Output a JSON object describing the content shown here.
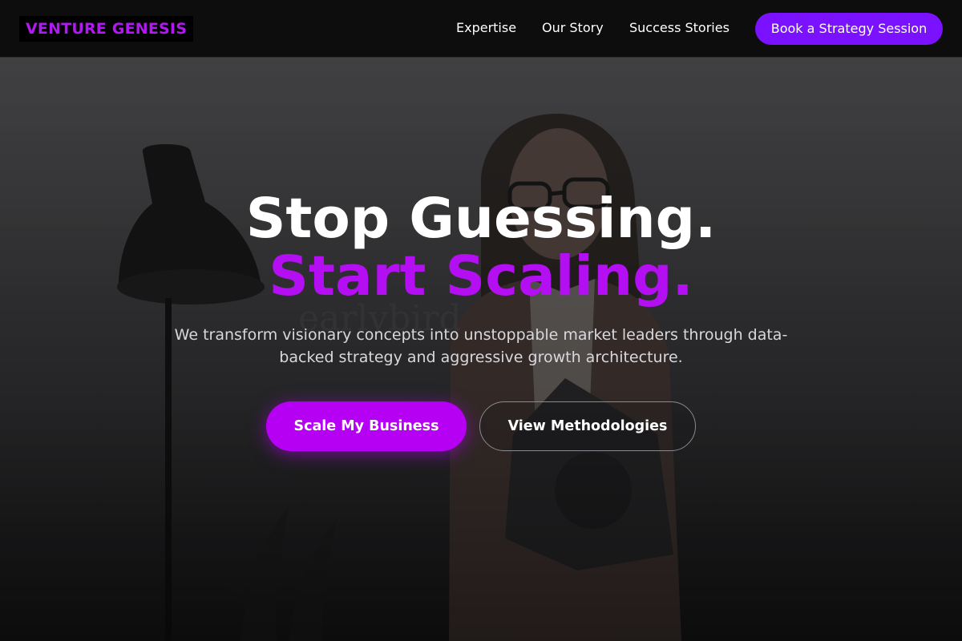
{
  "header": {
    "logo": "VENTURE GENESIS",
    "nav": [
      {
        "label": "Expertise"
      },
      {
        "label": "Our Story"
      },
      {
        "label": "Success Stories"
      }
    ],
    "cta_label": "Book a Strategy Session"
  },
  "hero": {
    "headline_line1": "Stop Guessing.",
    "headline_line2": "Start Scaling.",
    "subtext": "We transform visionary concepts into unstoppable market leaders through data-backed strategy and aggressive growth architecture.",
    "primary_button": "Scale My Business",
    "secondary_button": "View Methodologies"
  },
  "colors": {
    "brand_purple": "#b40ef2",
    "nav_button": "#7a12ff",
    "header_bg": "#0d0d0e"
  }
}
